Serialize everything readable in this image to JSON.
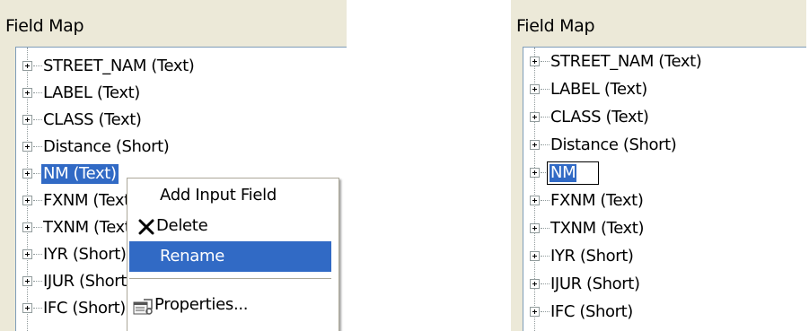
{
  "left_panel": {
    "title": "Field Map",
    "tree_items": [
      "STREET_NAM (Text)",
      "LABEL (Text)",
      "CLASS (Text)",
      "Distance (Short)",
      "NM (Text)",
      "FXNM (Text)",
      "TXNM (Text)",
      "IYR (Short)",
      "IJUR (Short)",
      "IFC (Short)"
    ],
    "selected_index": 4,
    "context_menu": {
      "items": [
        "Add Input Field",
        "Delete",
        "Rename",
        "Properties..."
      ],
      "highlighted": "Rename"
    }
  },
  "right_panel": {
    "title": "Field Map",
    "tree_items": [
      "STREET_NAM (Text)",
      "LABEL (Text)",
      "CLASS (Text)",
      "Distance (Short)",
      "NM",
      "FXNM (Text)",
      "TXNM (Text)",
      "IYR (Short)",
      "IJUR (Short)",
      "IFC (Short)"
    ],
    "editing_index": 4
  },
  "icons": [
    "expand-icon",
    "delete-x-icon",
    "properties-icon"
  ],
  "colors": {
    "selection": "#316ac5",
    "panel_bg": "#ece9d8"
  }
}
